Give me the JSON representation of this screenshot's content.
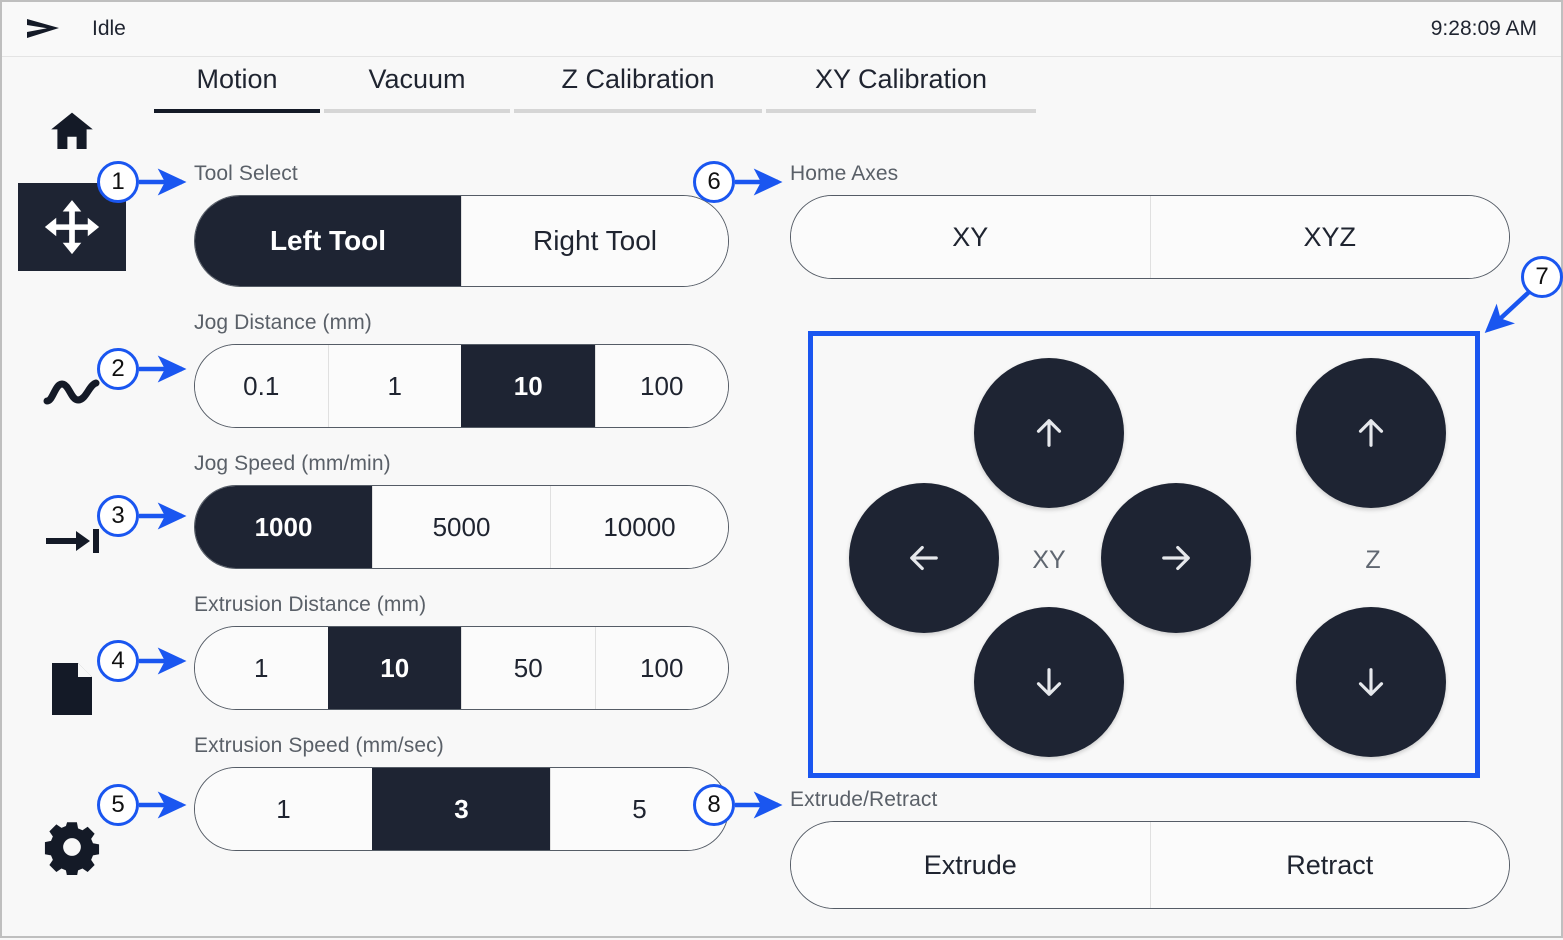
{
  "header": {
    "logo_icon": "send-arrow-logo-icon",
    "status": "Idle",
    "time": "9:28:09 AM"
  },
  "sidebar": {
    "items": [
      {
        "icon": "home-icon",
        "name": "home",
        "selected": false
      },
      {
        "icon": "move-arrows-icon",
        "name": "motion",
        "selected": true
      },
      {
        "icon": "wave-line-icon",
        "name": "graph",
        "selected": false
      },
      {
        "icon": "arrow-to-bar-icon",
        "name": "jog-to-limit",
        "selected": false
      },
      {
        "icon": "file-icon",
        "name": "files",
        "selected": false
      },
      {
        "icon": "gear-icon",
        "name": "settings",
        "selected": false
      }
    ]
  },
  "tabs": [
    {
      "label": "Motion",
      "active": true
    },
    {
      "label": "Vacuum",
      "active": false
    },
    {
      "label": "Z Calibration",
      "active": false
    },
    {
      "label": "XY Calibration",
      "active": false
    }
  ],
  "left_panel": {
    "tool_select": {
      "label": "Tool Select",
      "options": [
        "Left Tool",
        "Right Tool"
      ],
      "selected": "Left Tool"
    },
    "jog_distance": {
      "label": "Jog Distance (mm)",
      "options": [
        "0.1",
        "1",
        "10",
        "100"
      ],
      "selected": "10"
    },
    "jog_speed": {
      "label": "Jog Speed (mm/min)",
      "options": [
        "1000",
        "5000",
        "10000"
      ],
      "selected": "1000"
    },
    "extrusion_distance": {
      "label": "Extrusion Distance (mm)",
      "options": [
        "1",
        "10",
        "50",
        "100"
      ],
      "selected": "10"
    },
    "extrusion_speed": {
      "label": "Extrusion Speed (mm/sec)",
      "options": [
        "1",
        "3",
        "5"
      ],
      "selected": "3"
    }
  },
  "right_panel": {
    "home_axes": {
      "label": "Home Axes",
      "options": [
        "XY",
        "XYZ"
      ],
      "selected": null
    },
    "jog_pad": {
      "xy_label": "XY",
      "z_label": "Z",
      "buttons": [
        {
          "name": "jog-xy-up",
          "icon": "arrow-up-icon"
        },
        {
          "name": "jog-xy-left",
          "icon": "arrow-left-icon"
        },
        {
          "name": "jog-xy-right",
          "icon": "arrow-right-icon"
        },
        {
          "name": "jog-xy-down",
          "icon": "arrow-down-icon"
        },
        {
          "name": "jog-z-up",
          "icon": "arrow-up-icon"
        },
        {
          "name": "jog-z-down",
          "icon": "arrow-down-icon"
        }
      ]
    },
    "extrude_retract": {
      "label": "Extrude/Retract",
      "options": [
        "Extrude",
        "Retract"
      ],
      "selected": null
    }
  },
  "callouts": [
    {
      "number": "1"
    },
    {
      "number": "2"
    },
    {
      "number": "3"
    },
    {
      "number": "4"
    },
    {
      "number": "5"
    },
    {
      "number": "6"
    },
    {
      "number": "7"
    },
    {
      "number": "8"
    }
  ],
  "colors": {
    "accent_dark": "#1e2433",
    "callout_blue": "#1a56f0",
    "background": "#f8f8f8",
    "label_gray": "#5a6068"
  }
}
